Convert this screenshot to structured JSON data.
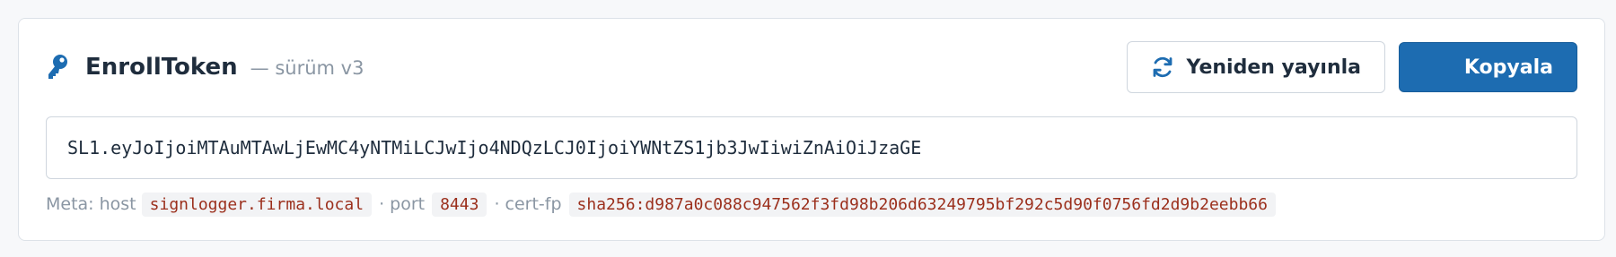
{
  "header": {
    "title": "EnrollToken",
    "version": "— sürüm v3",
    "icon": "key-icon",
    "accent_color": "#1d6cb1"
  },
  "actions": {
    "republish_label": "Yeniden yayınla",
    "republish_icon": "refresh-icon",
    "copy_label": "Kopyala"
  },
  "token": {
    "value": "SL1.eyJoIjoiMTAuMTAwLjEwMC4yNTMiLCJwIjo4NDQzLCJ0IjoiYWNtZS1jb3JwIiwiZnAiOiJzaGE"
  },
  "meta": {
    "prefix": "Meta: host",
    "host": "signlogger.firma.local",
    "port_label": "· port",
    "port": "8443",
    "certfp_label": "· cert-fp",
    "certfp": "sha256:d987a0c088c947562f3fd98b206d63249795bf292c5d90f0756fd2d9b2eebb66"
  }
}
